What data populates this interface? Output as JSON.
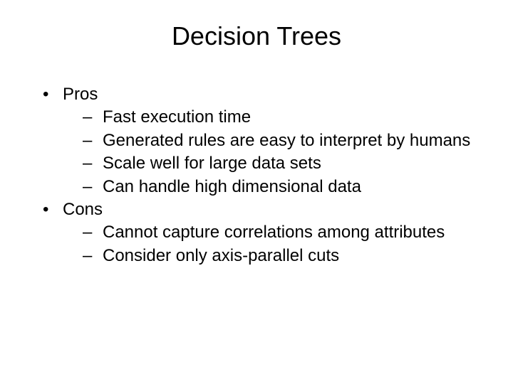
{
  "title": "Decision Trees",
  "sections": [
    {
      "label": "Pros",
      "items": [
        "Fast execution time",
        "Generated rules are easy to interpret by humans",
        "Scale well for large data sets",
        "Can handle high dimensional data"
      ]
    },
    {
      "label": "Cons",
      "items": [
        "Cannot capture correlations among attributes",
        "Consider only axis-parallel cuts"
      ]
    }
  ]
}
